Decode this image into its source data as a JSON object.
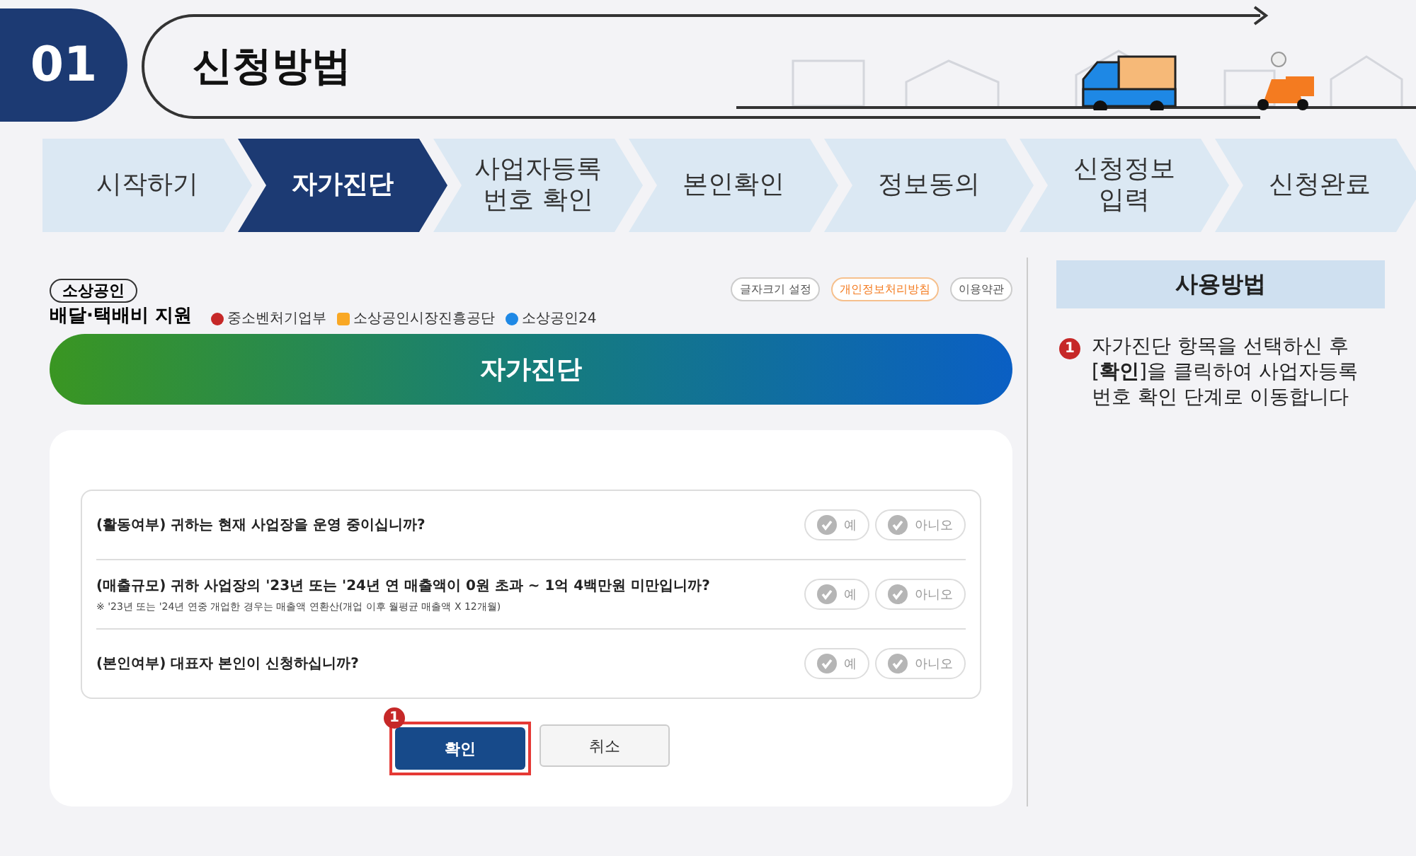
{
  "header": {
    "number": "01",
    "title": "신청방법"
  },
  "steps": [
    {
      "label": "시작하기",
      "selected": false
    },
    {
      "label": "자가진단",
      "selected": true
    },
    {
      "label": "사업자등록\n번호 확인",
      "selected": false
    },
    {
      "label": "본인확인",
      "selected": false
    },
    {
      "label": "정보동의",
      "selected": false
    },
    {
      "label": "신청정보\n입력",
      "selected": false
    },
    {
      "label": "신청완료",
      "selected": false
    }
  ],
  "site": {
    "logo_top": "소상공인",
    "logo_bottom": "배달·택배비 지원",
    "agencies": [
      "중소벤처기업부",
      "소상공인시장진흥공단",
      "소상공인24"
    ],
    "links": [
      "글자크기 설정",
      "개인정보처리방침",
      "이용약관"
    ]
  },
  "banner": "자가진단",
  "questions": [
    {
      "text": "(활동여부) 귀하는 현재 사업장을 운영 중이십니까?",
      "answers": [
        "예",
        "아니오"
      ]
    },
    {
      "text": "(매출규모) 귀하 사업장의 '23년 또는 '24년 연 매출액이 0원 초과 ~ 1억 4백만원 미만입니까?",
      "note": "※ '23년 또는 '24년 연중 개업한 경우는 매출액 연환산(개업 이후 월평균 매출액 X 12개월)",
      "answers": [
        "예",
        "아니오"
      ]
    },
    {
      "text": "(본인여부) 대표자 본인이 신청하십니까?",
      "answers": [
        "예",
        "아니오"
      ]
    }
  ],
  "buttons": [
    {
      "label": "확인",
      "kind": "primary",
      "marker": "1"
    },
    {
      "label": "취소",
      "kind": "secondary"
    }
  ],
  "guide": {
    "title": "사용방법",
    "steps": [
      {
        "marker": "1",
        "text": "자가진단 항목을 선택하신 후 [**확인**]을 클릭하여 사업자등록 번호 확인 단계로 이동합니다"
      }
    ]
  }
}
